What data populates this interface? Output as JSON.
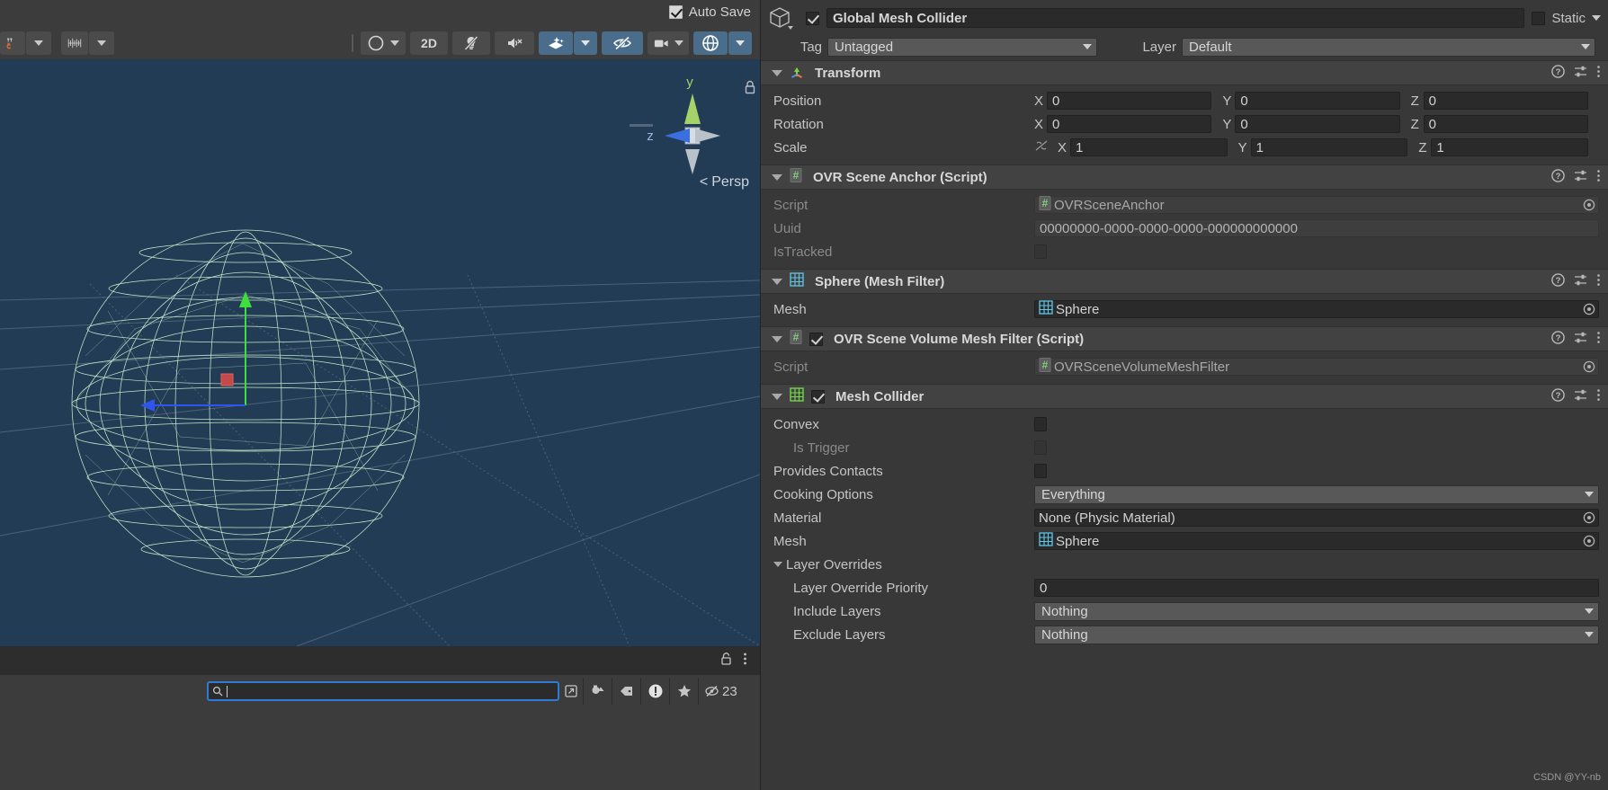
{
  "scene": {
    "autosave_label": "Auto Save",
    "autosave_checked": true,
    "toolbar": {
      "pivot_icon": "pivot-magnet-icon",
      "grid_icon": "grid-snap-icon",
      "shading_icon": "shading-mode-icon",
      "twod_label": "2D",
      "lighting_icon": "lighting-off-icon",
      "audio_icon": "audio-mute-icon",
      "fx_icon": "effects-icon",
      "visibility_icon": "scene-visibility-icon",
      "camera_icon": "camera-icon",
      "gizmos_icon": "gizmos-icon"
    },
    "gizmo": {
      "axis_y": "y",
      "axis_z": "z",
      "persp_label": "Persp",
      "persp_prefix": "<"
    },
    "search": {
      "value": "",
      "placeholder": ""
    },
    "footer": {
      "lock_icon": "lock-icon",
      "menu_icon": "kebab-menu-icon"
    },
    "statusbar": {
      "expand_icon": "expand-search-icon",
      "objects_icon": "objects-filter-icon",
      "tag_icon": "tag-filter-icon",
      "warning_icon": "warning-filter-icon",
      "favorite_icon": "favorite-filter-icon",
      "hidden_icon": "hidden-objects-icon",
      "hidden_count": "23"
    }
  },
  "inspector": {
    "gameobject": {
      "icon": "gameobject-cube-icon",
      "enabled": true,
      "name": "Global Mesh Collider",
      "static_label": "Static",
      "static_checked": false,
      "tag_label": "Tag",
      "tag_value": "Untagged",
      "layer_label": "Layer",
      "layer_value": "Default"
    },
    "components": [
      {
        "id": "transform",
        "title": "Transform",
        "icon": "transform-axes-icon",
        "expanded": true,
        "has_enable_toggle": false,
        "rows": [
          {
            "type": "vec3",
            "label": "Position",
            "x": "0",
            "y": "0",
            "z": "0"
          },
          {
            "type": "vec3",
            "label": "Rotation",
            "x": "0",
            "y": "0",
            "z": "0"
          },
          {
            "type": "vec3",
            "label": "Scale",
            "x": "1",
            "y": "1",
            "z": "1",
            "link_icon": "constrain-proportions-off-icon"
          }
        ]
      },
      {
        "id": "ovr-scene-anchor",
        "title": "OVR Scene Anchor (Script)",
        "icon": "cs-script-icon",
        "expanded": true,
        "has_enable_toggle": false,
        "rows": [
          {
            "type": "object",
            "label": "Script",
            "value": "OVRSceneAnchor",
            "readonly": true,
            "icon": "cs-script-icon"
          },
          {
            "type": "text",
            "label": "Uuid",
            "value": "00000000-0000-0000-0000-000000000000",
            "readonly": true
          },
          {
            "type": "checkbox",
            "label": "IsTracked",
            "checked": false,
            "dim": true
          }
        ]
      },
      {
        "id": "mesh-filter",
        "title": "Sphere (Mesh Filter)",
        "icon": "mesh-filter-icon",
        "expanded": true,
        "has_enable_toggle": false,
        "rows": [
          {
            "type": "object",
            "label": "Mesh",
            "value": "Sphere",
            "readonly": false,
            "icon": "mesh-icon"
          }
        ]
      },
      {
        "id": "ovr-scene-volume-mesh-filter",
        "title": "OVR Scene Volume Mesh Filter (Script)",
        "icon": "cs-script-icon",
        "expanded": true,
        "has_enable_toggle": true,
        "enabled": true,
        "rows": [
          {
            "type": "object",
            "label": "Script",
            "value": "OVRSceneVolumeMeshFilter",
            "readonly": true,
            "icon": "cs-script-icon"
          }
        ]
      },
      {
        "id": "mesh-collider",
        "title": "Mesh Collider",
        "icon": "mesh-collider-icon",
        "expanded": true,
        "has_enable_toggle": true,
        "enabled": true,
        "rows": [
          {
            "type": "checkbox",
            "label": "Convex",
            "checked": false,
            "dim": false
          },
          {
            "type": "checkbox",
            "label": "Is Trigger",
            "checked": false,
            "dim": true,
            "indent": 1
          },
          {
            "type": "checkbox",
            "label": "Provides Contacts",
            "checked": false,
            "dim": false
          },
          {
            "type": "dropdown",
            "label": "Cooking Options",
            "value": "Everything"
          },
          {
            "type": "object",
            "label": "Material",
            "value": "None (Physic Material)",
            "readonly": false
          },
          {
            "type": "object",
            "label": "Mesh",
            "value": "Sphere",
            "readonly": false,
            "icon": "mesh-icon"
          },
          {
            "type": "foldout",
            "label": "Layer Overrides",
            "expanded": true
          },
          {
            "type": "text",
            "label": "Layer Override Priority",
            "value": "0",
            "readonly": false,
            "indent": 1
          },
          {
            "type": "dropdown",
            "label": "Include Layers",
            "value": "Nothing",
            "indent": 1
          },
          {
            "type": "dropdown",
            "label": "Exclude Layers",
            "value": "Nothing",
            "indent": 1
          }
        ]
      }
    ],
    "watermark": "CSDN @YY-nb"
  }
}
